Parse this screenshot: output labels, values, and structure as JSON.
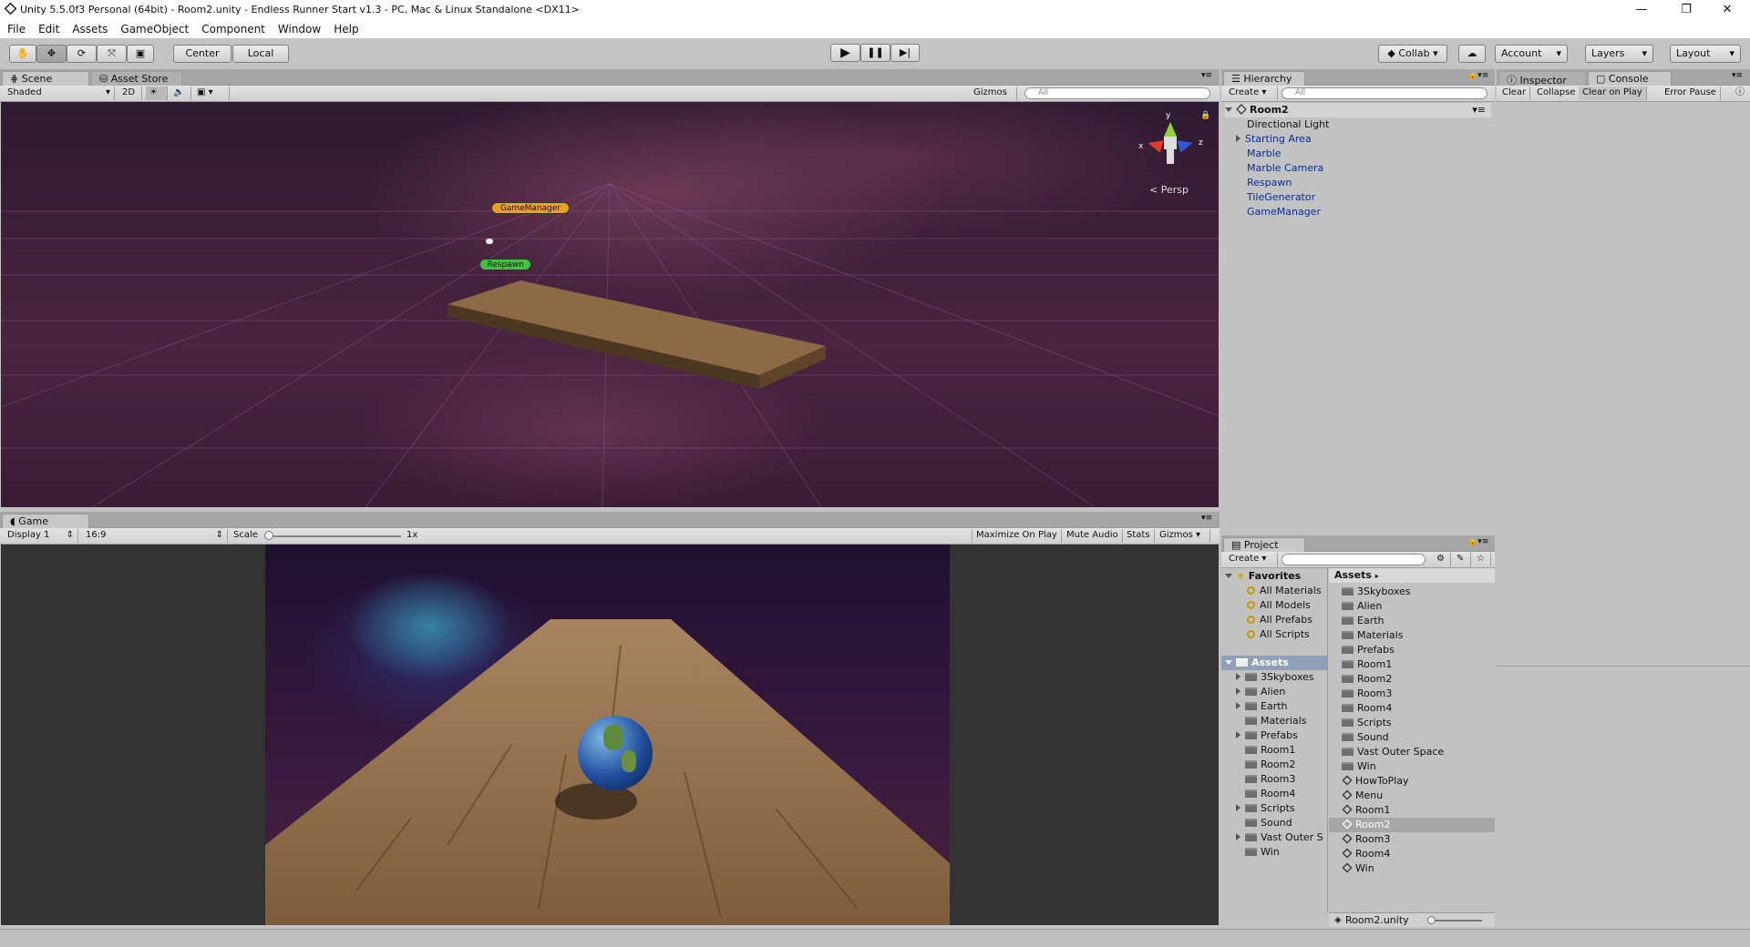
{
  "window": {
    "title": "Unity 5.5.0f3 Personal (64bit) - Room2.unity - Endless Runner Start v1.3 - PC, Mac & Linux Standalone <DX11>",
    "min": "—",
    "restore": "❐",
    "close": "✕"
  },
  "menu": [
    "File",
    "Edit",
    "Assets",
    "GameObject",
    "Component",
    "Window",
    "Help"
  ],
  "toolbar": {
    "pivot": "Center",
    "space": "Local",
    "collab": "Collab",
    "account": "Account",
    "layers": "Layers",
    "layout": "Layout"
  },
  "scene": {
    "tab": "Scene",
    "store_tab": "Asset Store",
    "shading": "Shaded",
    "mode2d": "2D",
    "gizmos": "Gizmos",
    "search_placeholder": "All",
    "persp": "Persp",
    "gm_label": "GameManager",
    "respawn_label": "Respawn",
    "axis": {
      "y": "y",
      "x": "x",
      "z": "z"
    }
  },
  "game": {
    "tab": "Game",
    "display": "Display 1",
    "aspect": "16:9",
    "scale_label": "Scale",
    "scale_value": "1x",
    "maximize": "Maximize On Play",
    "mute": "Mute Audio",
    "stats": "Stats",
    "gizmos": "Gizmos",
    "scale_fraction": 0.0
  },
  "hierarchy": {
    "tab": "Hierarchy",
    "create": "Create",
    "search_placeholder": "All",
    "scene_name": "Room2",
    "items": [
      "Directional Light",
      "Starting Area",
      "Marble",
      "Marble Camera",
      "Respawn",
      "TileGenerator",
      "GameManager"
    ]
  },
  "inspector": {
    "tab": "Inspector"
  },
  "console": {
    "tab": "Console",
    "clear": "Clear",
    "collapse": "Collapse",
    "clear_on_play": "Clear on Play",
    "error_pause": "Error Pause"
  },
  "project": {
    "tab": "Project",
    "create": "Create",
    "favorites_label": "Favorites",
    "favorites": [
      "All Materials",
      "All Models",
      "All Prefabs",
      "All Scripts"
    ],
    "assets_label": "Assets",
    "tree": [
      "3Skyboxes",
      "Alien",
      "Earth",
      "Materials",
      "Prefabs",
      "Room1",
      "Room2",
      "Room3",
      "Room4",
      "Scripts",
      "Sound",
      "Vast Outer S",
      "Win"
    ],
    "breadcrumb": "Assets",
    "content_folders": [
      "3Skyboxes",
      "Alien",
      "Earth",
      "Materials",
      "Prefabs",
      "Room1",
      "Room2",
      "Room3",
      "Room4",
      "Scripts",
      "Sound",
      "Vast Outer Space",
      "Win"
    ],
    "content_scenes": [
      "HowToPlay",
      "Menu",
      "Room1",
      "Room2",
      "Room3",
      "Room4",
      "Win"
    ],
    "selected": "Room2",
    "footer": "Room2.unity"
  }
}
